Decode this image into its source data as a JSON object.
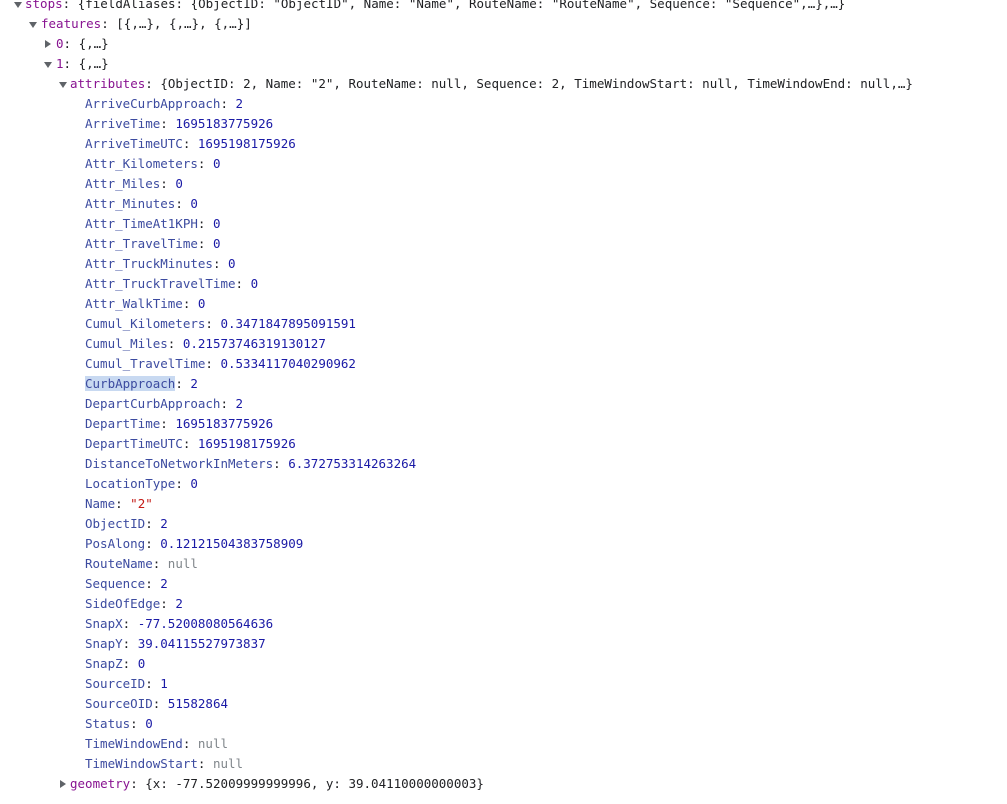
{
  "rows": [
    {
      "indent": 0,
      "toggle": "down",
      "key": "stops",
      "kind": "preview",
      "value": "{fieldAliases: {ObjectID: \"ObjectID\", Name: \"Name\", RouteName: \"RouteName\", Sequence: \"Sequence\",…},…}"
    },
    {
      "indent": 1,
      "toggle": "down",
      "key": "features",
      "kind": "preview",
      "value": "[{,…}, {,…}, {,…}]"
    },
    {
      "indent": 2,
      "toggle": "right",
      "key": "0",
      "kind": "preview",
      "value": "{,…}"
    },
    {
      "indent": 2,
      "toggle": "down",
      "key": "1",
      "kind": "preview",
      "value": "{,…}"
    },
    {
      "indent": 3,
      "toggle": "down",
      "key": "attributes",
      "kind": "preview",
      "value": "{ObjectID: 2, Name: \"2\", RouteName: null, Sequence: 2, TimeWindowStart: null, TimeWindowEnd: null,…}"
    },
    {
      "indent": 4,
      "toggle": "none",
      "key": "ArriveCurbApproach",
      "kind": "num",
      "value": "2"
    },
    {
      "indent": 4,
      "toggle": "none",
      "key": "ArriveTime",
      "kind": "num",
      "value": "1695183775926"
    },
    {
      "indent": 4,
      "toggle": "none",
      "key": "ArriveTimeUTC",
      "kind": "num",
      "value": "1695198175926"
    },
    {
      "indent": 4,
      "toggle": "none",
      "key": "Attr_Kilometers",
      "kind": "num",
      "value": "0"
    },
    {
      "indent": 4,
      "toggle": "none",
      "key": "Attr_Miles",
      "kind": "num",
      "value": "0"
    },
    {
      "indent": 4,
      "toggle": "none",
      "key": "Attr_Minutes",
      "kind": "num",
      "value": "0"
    },
    {
      "indent": 4,
      "toggle": "none",
      "key": "Attr_TimeAt1KPH",
      "kind": "num",
      "value": "0"
    },
    {
      "indent": 4,
      "toggle": "none",
      "key": "Attr_TravelTime",
      "kind": "num",
      "value": "0"
    },
    {
      "indent": 4,
      "toggle": "none",
      "key": "Attr_TruckMinutes",
      "kind": "num",
      "value": "0"
    },
    {
      "indent": 4,
      "toggle": "none",
      "key": "Attr_TruckTravelTime",
      "kind": "num",
      "value": "0"
    },
    {
      "indent": 4,
      "toggle": "none",
      "key": "Attr_WalkTime",
      "kind": "num",
      "value": "0"
    },
    {
      "indent": 4,
      "toggle": "none",
      "key": "Cumul_Kilometers",
      "kind": "num",
      "value": "0.3471847895091591"
    },
    {
      "indent": 4,
      "toggle": "none",
      "key": "Cumul_Miles",
      "kind": "num",
      "value": "0.21573746319130127"
    },
    {
      "indent": 4,
      "toggle": "none",
      "key": "Cumul_TravelTime",
      "kind": "num",
      "value": "0.5334117040290962"
    },
    {
      "indent": 4,
      "toggle": "none",
      "key": "CurbApproach",
      "kind": "num",
      "value": "2",
      "selected": true
    },
    {
      "indent": 4,
      "toggle": "none",
      "key": "DepartCurbApproach",
      "kind": "num",
      "value": "2"
    },
    {
      "indent": 4,
      "toggle": "none",
      "key": "DepartTime",
      "kind": "num",
      "value": "1695183775926"
    },
    {
      "indent": 4,
      "toggle": "none",
      "key": "DepartTimeUTC",
      "kind": "num",
      "value": "1695198175926"
    },
    {
      "indent": 4,
      "toggle": "none",
      "key": "DistanceToNetworkInMeters",
      "kind": "num",
      "value": "6.372753314263264"
    },
    {
      "indent": 4,
      "toggle": "none",
      "key": "LocationType",
      "kind": "num",
      "value": "0"
    },
    {
      "indent": 4,
      "toggle": "none",
      "key": "Name",
      "kind": "str",
      "value": "\"2\""
    },
    {
      "indent": 4,
      "toggle": "none",
      "key": "ObjectID",
      "kind": "num",
      "value": "2"
    },
    {
      "indent": 4,
      "toggle": "none",
      "key": "PosAlong",
      "kind": "num",
      "value": "0.12121504383758909"
    },
    {
      "indent": 4,
      "toggle": "none",
      "key": "RouteName",
      "kind": "nul",
      "value": "null"
    },
    {
      "indent": 4,
      "toggle": "none",
      "key": "Sequence",
      "kind": "num",
      "value": "2"
    },
    {
      "indent": 4,
      "toggle": "none",
      "key": "SideOfEdge",
      "kind": "num",
      "value": "2"
    },
    {
      "indent": 4,
      "toggle": "none",
      "key": "SnapX",
      "kind": "num",
      "value": "-77.52008080564636"
    },
    {
      "indent": 4,
      "toggle": "none",
      "key": "SnapY",
      "kind": "num",
      "value": "39.04115527973837"
    },
    {
      "indent": 4,
      "toggle": "none",
      "key": "SnapZ",
      "kind": "num",
      "value": "0"
    },
    {
      "indent": 4,
      "toggle": "none",
      "key": "SourceID",
      "kind": "num",
      "value": "1"
    },
    {
      "indent": 4,
      "toggle": "none",
      "key": "SourceOID",
      "kind": "num",
      "value": "51582864"
    },
    {
      "indent": 4,
      "toggle": "none",
      "key": "Status",
      "kind": "num",
      "value": "0"
    },
    {
      "indent": 4,
      "toggle": "none",
      "key": "TimeWindowEnd",
      "kind": "nul",
      "value": "null"
    },
    {
      "indent": 4,
      "toggle": "none",
      "key": "TimeWindowStart",
      "kind": "nul",
      "value": "null"
    },
    {
      "indent": 3,
      "toggle": "right",
      "key": "geometry",
      "kind": "preview",
      "value": "{x: -77.52009999999996, y: 39.04110000000003}"
    }
  ]
}
